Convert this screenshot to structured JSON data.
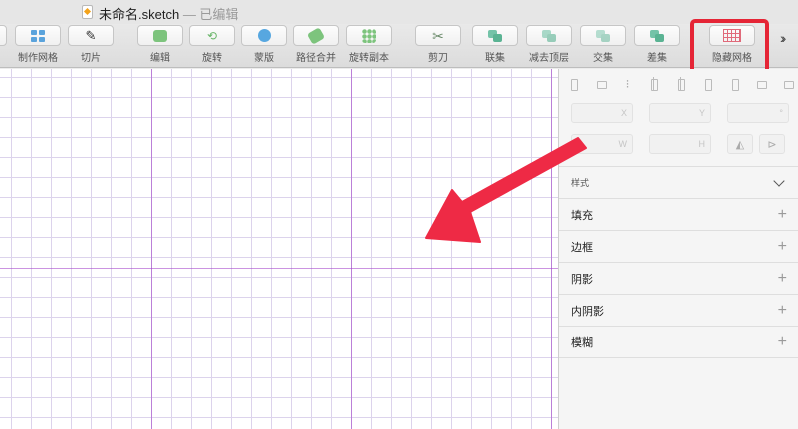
{
  "window": {
    "title": "未命名.sketch",
    "subtitle": "— 已编辑"
  },
  "toolbar": {
    "tools": [
      {
        "id": "grid",
        "label": "制作网格"
      },
      {
        "id": "slice",
        "label": "切片"
      },
      {
        "id": "edit",
        "label": "编辑"
      },
      {
        "id": "rotate",
        "label": "旋转"
      },
      {
        "id": "mask",
        "label": "蒙版"
      },
      {
        "id": "path-combine",
        "label": "路径合并"
      },
      {
        "id": "rotate-copy",
        "label": "旋转副本"
      },
      {
        "id": "scissors",
        "label": "剪刀"
      },
      {
        "id": "union",
        "label": "联集"
      },
      {
        "id": "subtract",
        "label": "减去顶层"
      },
      {
        "id": "intersect",
        "label": "交集"
      },
      {
        "id": "difference",
        "label": "差集"
      },
      {
        "id": "hide-grid",
        "label": "隐藏网格"
      }
    ],
    "more_label": "››"
  },
  "inspector": {
    "fields": {
      "x": "X",
      "y": "Y",
      "rotation": "°",
      "w": "W",
      "h": "H"
    },
    "style_header": "样式",
    "sections": [
      {
        "name": "填充",
        "action": "+"
      },
      {
        "name": "边框",
        "action": "+"
      },
      {
        "name": "阴影",
        "action": "+"
      },
      {
        "name": "内阴影",
        "action": "+"
      },
      {
        "name": "模糊",
        "action": "+"
      }
    ]
  },
  "colors": {
    "highlight": "#e52536",
    "arrow": "#ee2a45",
    "grid_major": "#a03cc8",
    "grid_minor": "#dcd3ec"
  }
}
